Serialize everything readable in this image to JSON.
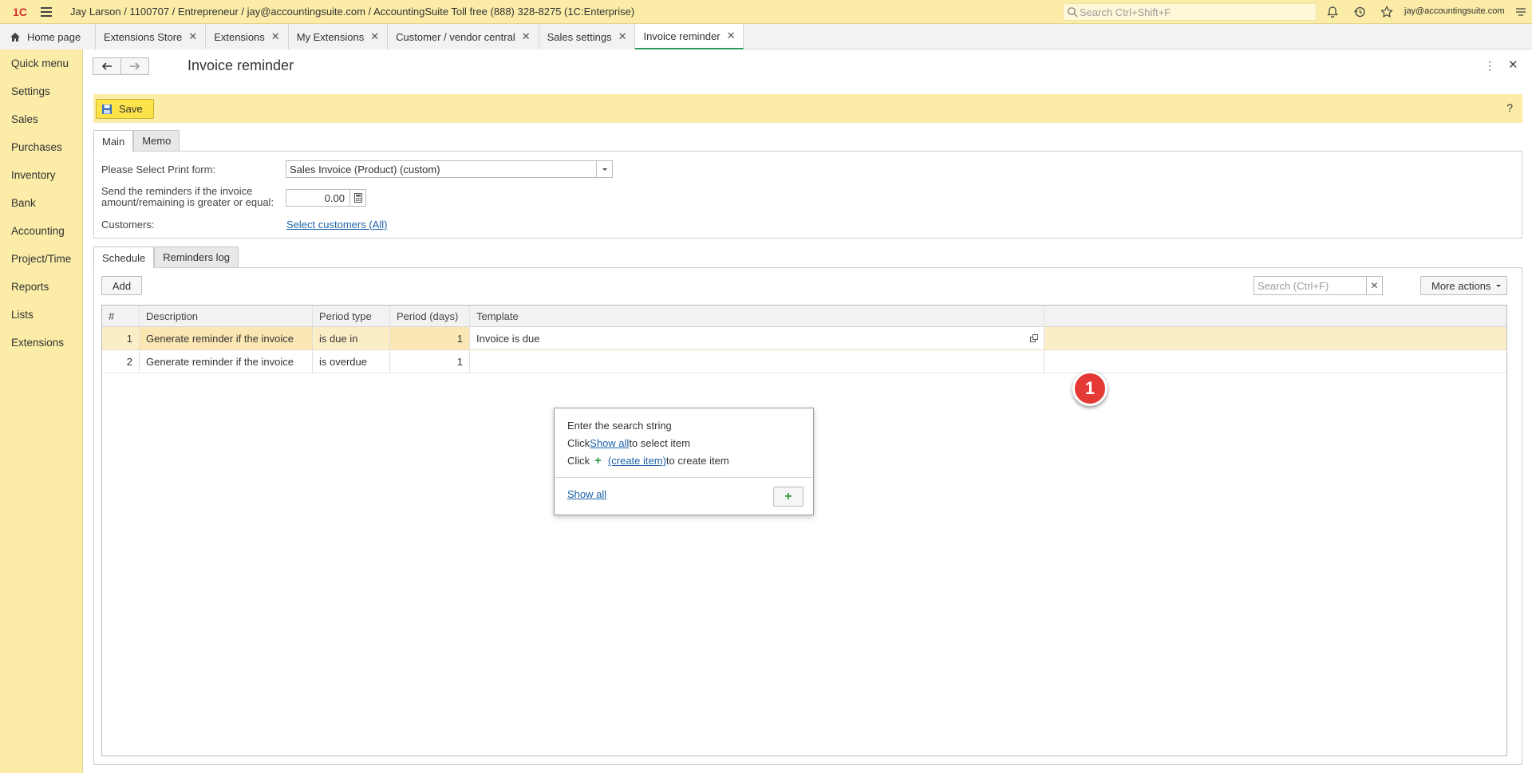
{
  "topbar": {
    "logo": "1C",
    "user_info": "Jay Larson / 1100707 / Entrepreneur / jay@accountingsuite.com / AccountingSuite Toll free (888) 328-8275   (1C:Enterprise)",
    "search_placeholder": "Search Ctrl+Shift+F",
    "user_email": "jay@accountingsuite.com"
  },
  "open_tabs": [
    {
      "label": "Home page"
    },
    {
      "label": "Extensions Store"
    },
    {
      "label": "Extensions"
    },
    {
      "label": "My Extensions"
    },
    {
      "label": "Customer / vendor central"
    },
    {
      "label": "Sales settings"
    },
    {
      "label": "Invoice reminder",
      "active": true
    }
  ],
  "sidebar": {
    "items": [
      {
        "label": "Quick menu"
      },
      {
        "label": "Settings"
      },
      {
        "label": "Sales"
      },
      {
        "label": "Purchases"
      },
      {
        "label": "Inventory"
      },
      {
        "label": "Bank"
      },
      {
        "label": "Accounting"
      },
      {
        "label": "Project/Time"
      },
      {
        "label": "Reports"
      },
      {
        "label": "Lists"
      },
      {
        "label": "Extensions"
      }
    ]
  },
  "form": {
    "title": "Invoice reminder",
    "save_label": "Save",
    "help_label": "?",
    "tabs": [
      {
        "label": "Main"
      },
      {
        "label": "Memo"
      }
    ],
    "print_form_label": "Please Select Print form:",
    "print_form_value": "Sales Invoice (Product) (custom)",
    "threshold_label_line1": "Send the reminders if the invoice",
    "threshold_label_line2": "amount/remaining is greater or equal:",
    "threshold_value": "0.00",
    "customers_label": "Customers:",
    "customers_link": "Select customers (All)"
  },
  "schedule": {
    "tabs": [
      {
        "label": "Schedule"
      },
      {
        "label": "Reminders log"
      }
    ],
    "add_label": "Add",
    "search_placeholder": "Search (Ctrl+F)",
    "more_actions_label": "More actions",
    "columns": [
      "#",
      "Description",
      "Period type",
      "Period (days)",
      "Template"
    ],
    "rows": [
      {
        "idx": "1",
        "description": "Generate reminder if the invoice",
        "period_type": "is due in",
        "period_days": "1",
        "template": "Invoice is due"
      },
      {
        "idx": "2",
        "description": "Generate reminder if the invoice",
        "period_type": "is overdue",
        "period_days": "1",
        "template": ""
      }
    ]
  },
  "dropdown": {
    "line1": "Enter the search string",
    "line2_pre": "Click ",
    "line2_link": "Show all",
    "line2_post": " to select item",
    "line3_pre": "Click ",
    "line3_link": "(create item)",
    "line3_post": " to create item",
    "show_all": "Show all"
  },
  "step_badge": "1",
  "colors": {
    "accent_yellow": "#fbeca8",
    "save_button": "#fde34a",
    "link_blue": "#1e63a8",
    "active_tab_underline": "#2d9a5c",
    "badge_red": "#e53935"
  }
}
